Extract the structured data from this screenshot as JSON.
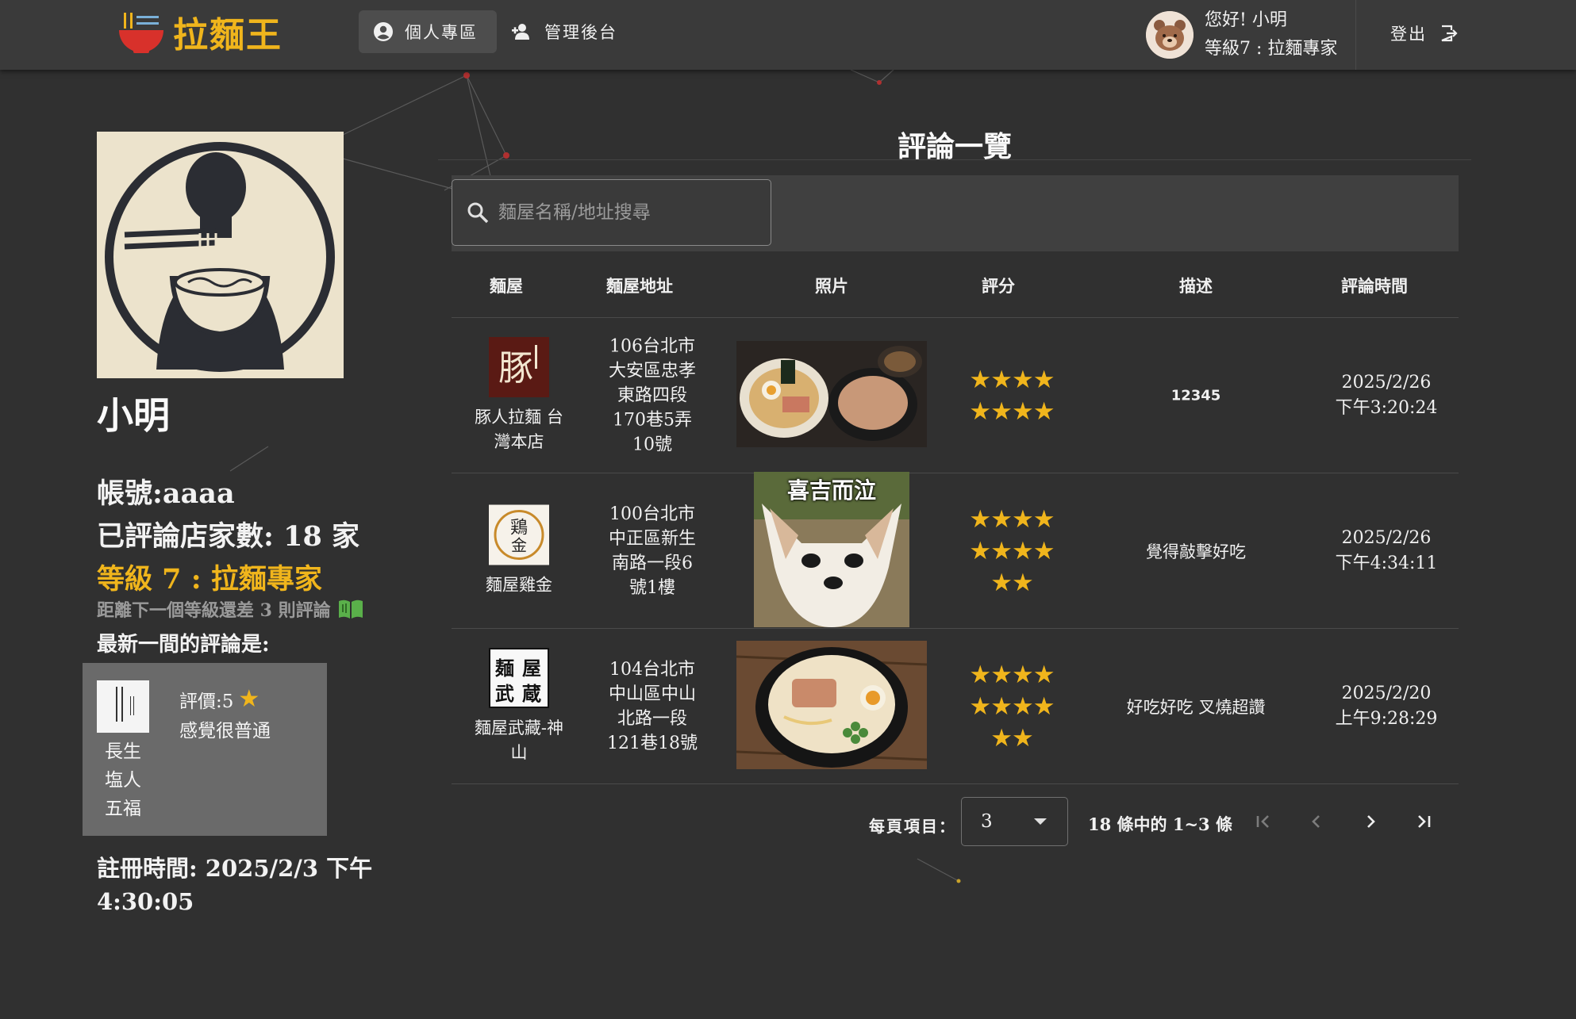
{
  "app": {
    "brand": "拉麵王"
  },
  "nav": {
    "profile": "個人專區",
    "admin": "管理後台"
  },
  "user": {
    "greeting": "您好! 小明",
    "level": "等級7 : 拉麵專家",
    "logout": "登出"
  },
  "profile": {
    "name": "小明",
    "account": "帳號:aaaa",
    "review_count": "已評論店家數: 18 家",
    "level": "等級 7 : 拉麵專家",
    "next_level": "距離下一個等級還差 3 則評論",
    "latest_label": "最新一間的評論是:",
    "latest": {
      "shop": "長生塩人五福",
      "rating": "評價:5",
      "comment": "感覺很普通"
    },
    "register": "註冊時間: 2025/2/3 下午4:30:05"
  },
  "reviews": {
    "title": "評論一覽",
    "search_placeholder": "麵屋名稱/地址搜尋",
    "columns": [
      "麵屋",
      "麵屋地址",
      "照片",
      "評分",
      "描述",
      "評論時間"
    ],
    "rows": [
      {
        "shop": "豚人拉麵 台灣本店",
        "address": "106台北市大安區忠孝東路四段170巷5弄10號",
        "stars": 8,
        "description": "12345",
        "date": "2025/2/26",
        "time": "下午3:20:24"
      },
      {
        "shop": "麵屋雞金",
        "address": "100台北市中正區新生南路一段6號1樓",
        "stars": 10,
        "description": "覺得敲擊好吃",
        "photo_caption": "喜吉而泣",
        "date": "2025/2/26",
        "time": "下午4:34:11"
      },
      {
        "shop": "麵屋武藏-神山",
        "address": "104台北市中山區中山北路一段121巷18號",
        "stars": 10,
        "description": "好吃好吃  叉燒超讚",
        "date": "2025/2/20",
        "time": "上午9:28:29"
      }
    ],
    "pager": {
      "label": "每頁項目：",
      "per_page": "3",
      "range": "18 條中的 1~3 條"
    }
  },
  "colors": {
    "accent": "#f0b51c",
    "background": "#303030",
    "topbar": "#3a3a3a"
  }
}
